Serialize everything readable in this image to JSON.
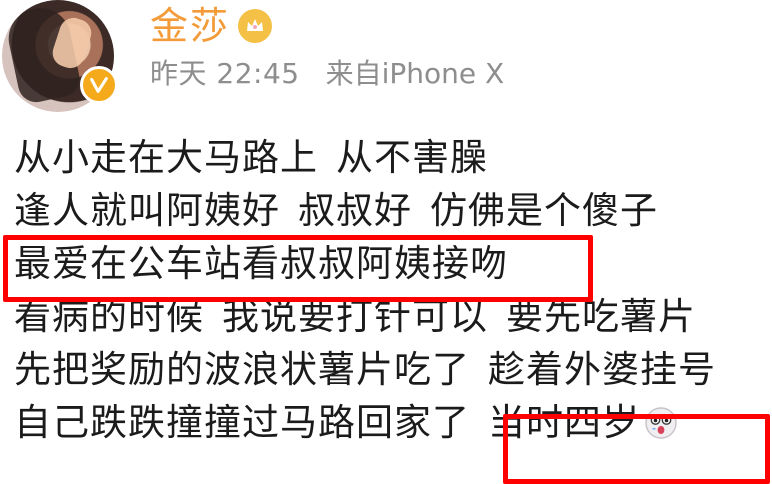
{
  "post": {
    "username": "金莎",
    "meta": {
      "day": "昨天",
      "time": "22:45",
      "source": "来自iPhone X"
    },
    "lines": [
      {
        "segments": [
          "从小走在大马路上",
          "从不害臊"
        ]
      },
      {
        "segments": [
          "逢人就叫阿姨好",
          "叔叔好",
          "仿佛是个傻子"
        ]
      },
      {
        "segments": [
          "最爱在公车站看叔叔阿姨接吻"
        ]
      },
      {
        "segments": [
          "看病的时候",
          "我说要打针可以",
          "要先吃薯片"
        ]
      },
      {
        "segments": [
          "先把奖励的波浪状薯片吃了",
          "趁着外婆挂号"
        ]
      },
      {
        "segments": [
          "自己跌跌撞撞过马路回家了",
          "当时四岁"
        ]
      }
    ]
  },
  "colors": {
    "username": "#f29b38",
    "meta": "#8e8e8e",
    "highlight": "#ff0000",
    "verified": "#f4aa1b"
  },
  "icons": {
    "vip": "crown-badge-icon",
    "verified": "verified-badge-icon",
    "emoji": "surprised-face-emoji-icon"
  }
}
